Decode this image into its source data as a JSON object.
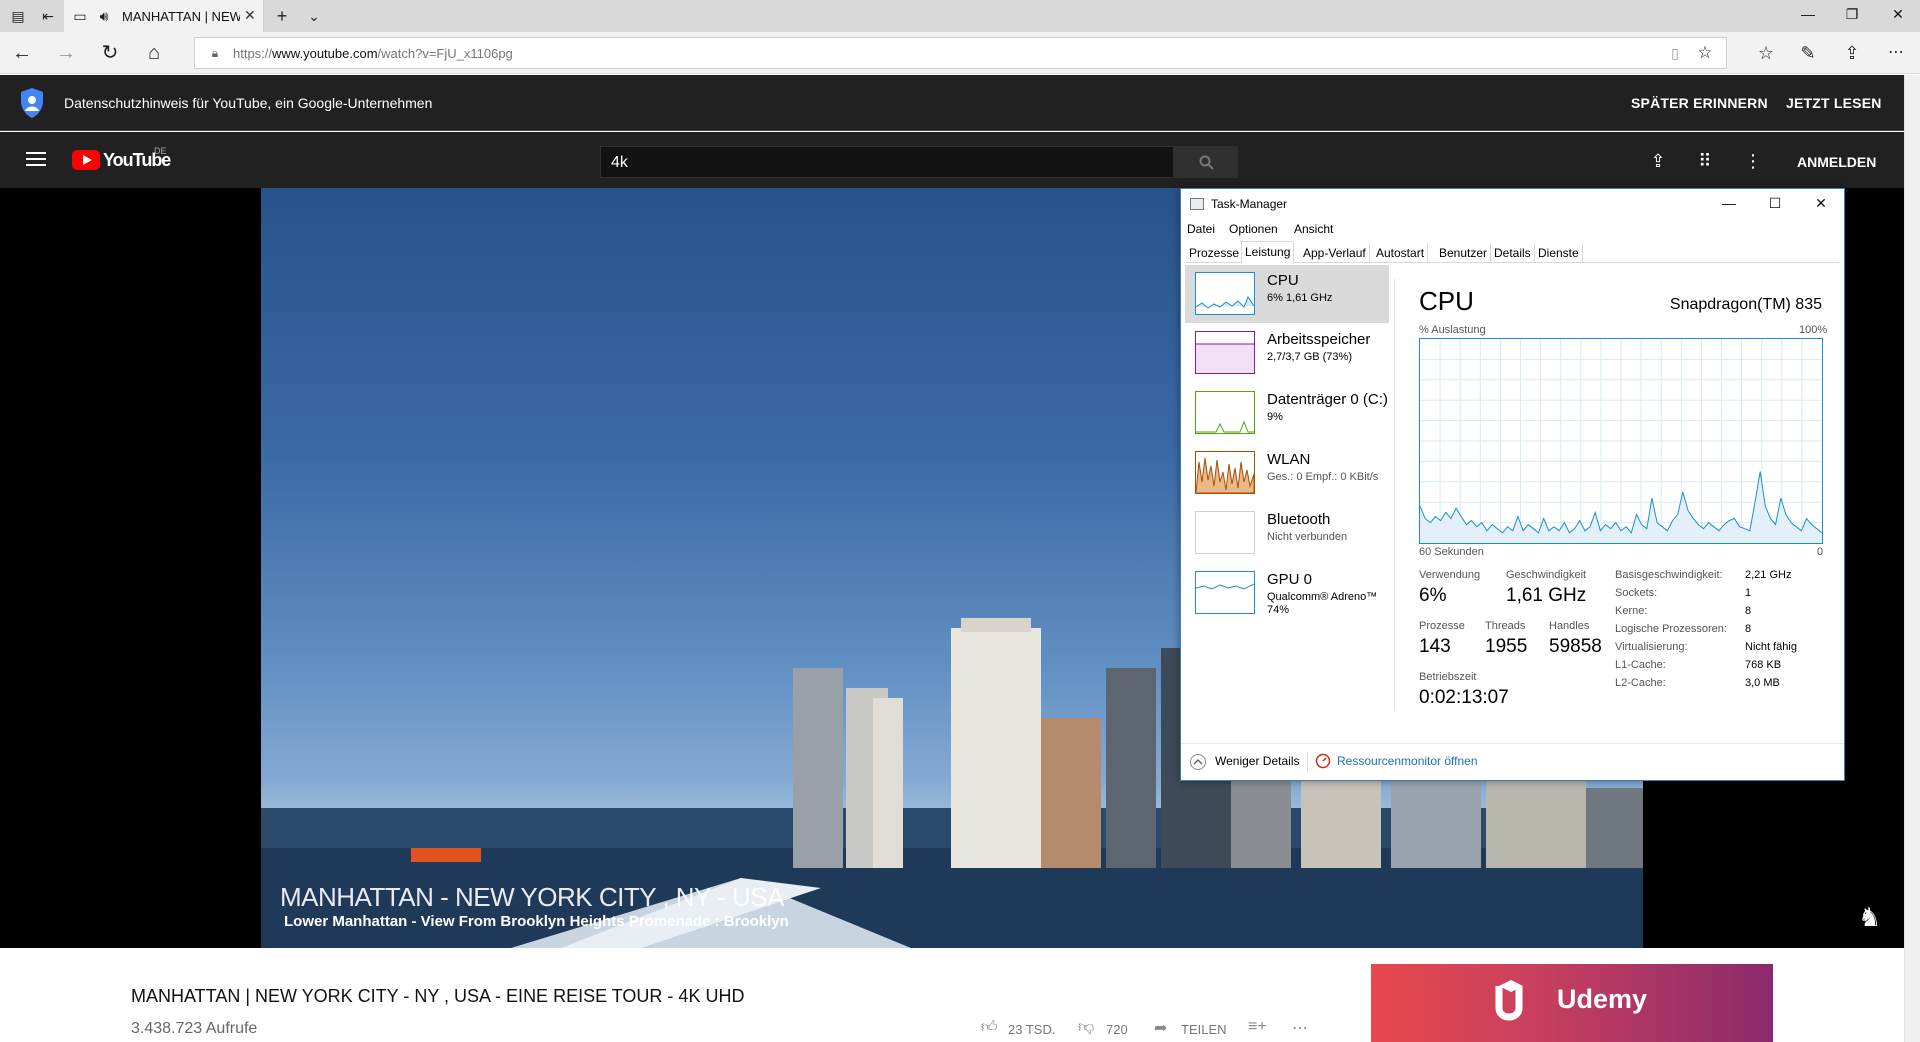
{
  "browser": {
    "tab_title": "MANHATTAN | NEW YORK CITY",
    "url_prefix": "https://",
    "url_host": "www.youtube.com",
    "url_path": "/watch?v=FjU_x1106pg"
  },
  "banner": {
    "text": "Datenschutzhinweis für YouTube, ein Google-Unternehmen",
    "remind_label": "SPÄTER ERINNERN",
    "read_label": "JETZT LESEN"
  },
  "masthead": {
    "logo_text": "YouTube",
    "region": "DE",
    "search_value": "4k",
    "signin_label": "ANMELDEN"
  },
  "video": {
    "overlay_title": "MANHATTAN - NEW YORK CITY , NY - USA",
    "overlay_subtitle": "Lower Manhattan - View From Brooklyn Heights Promenade : Brooklyn",
    "title": "MANHATTAN | NEW YORK CITY - NY , USA - EINE REISE TOUR - 4K UHD",
    "views": "3.438.723 Aufrufe",
    "likes": "23 TSD.",
    "dislikes": "720",
    "share_label": "TEILEN"
  },
  "ad": {
    "brand": "Udemy",
    "color_start": "#e8484c",
    "color_end": "#8a2a6c"
  },
  "taskmanager": {
    "title": "Task-Manager",
    "menu": [
      "Datei",
      "Optionen",
      "Ansicht"
    ],
    "tabs": [
      "Prozesse",
      "Leistung",
      "App-Verlauf",
      "Autostart",
      "Benutzer",
      "Details",
      "Dienste"
    ],
    "active_tab": "Leistung",
    "items": [
      {
        "name": "CPU",
        "sub": "6% 1,61 GHz",
        "color": "#1c8ecf"
      },
      {
        "name": "Arbeitsspeicher",
        "sub": "2,7/3,7 GB (73%)",
        "color": "#8b12ae"
      },
      {
        "name": "Datenträger 0 (C:)",
        "sub": "9%",
        "color": "#4da60c"
      },
      {
        "name": "WLAN",
        "sub_label": "Ges.: 0 Empf.: 0 KBit/s",
        "sub": "Ges.: 0 Empf.: 0 KBit/s",
        "color": "#a74f01"
      },
      {
        "name": "Bluetooth",
        "sub": "Nicht verbunden",
        "color": "#cfcfcf"
      },
      {
        "name": "GPU 0",
        "sub": "Qualcomm® Adreno™",
        "sub2": "74%",
        "color": "#1c8ecf"
      }
    ],
    "detail": {
      "heading": "CPU",
      "processor": "Snapdragon(TM) 835",
      "util_label": "% Auslastung",
      "max_label": "100%",
      "time_label": "60 Sekunden",
      "min_label": "0",
      "usage_label": "Verwendung",
      "usage": "6%",
      "speed_label": "Geschwindigkeit",
      "speed": "1,61 GHz",
      "proc_label": "Prozesse",
      "procs": "143",
      "threads_label": "Threads",
      "threads": "1955",
      "handles_label": "Handles",
      "handles": "59858",
      "uptime_label": "Betriebszeit",
      "uptime": "0:02:13:07",
      "specs": [
        {
          "k": "Basisgeschwindigkeit:",
          "v": "2,21 GHz"
        },
        {
          "k": "Sockets:",
          "v": "1"
        },
        {
          "k": "Kerne:",
          "v": "8"
        },
        {
          "k": "Logische Prozessoren:",
          "v": "8"
        },
        {
          "k": "Virtualisierung:",
          "v": "Nicht fähig"
        },
        {
          "k": "L1-Cache:",
          "v": "768 KB"
        },
        {
          "k": "L2-Cache:",
          "v": "3,0 MB"
        }
      ],
      "cpu_history": [
        18,
        12,
        10,
        13,
        11,
        15,
        12,
        17,
        13,
        9,
        11,
        8,
        10,
        6,
        9,
        7,
        5,
        8,
        6,
        13,
        6,
        9,
        7,
        5,
        12,
        6,
        8,
        6,
        10,
        5,
        7,
        11,
        6,
        8,
        15,
        6,
        9,
        7,
        10,
        6,
        8,
        5,
        14,
        9,
        7,
        22,
        10,
        8,
        6,
        11,
        14,
        25,
        16,
        12,
        9,
        7,
        10,
        8,
        6,
        9,
        11,
        12,
        8,
        7,
        6,
        20,
        35,
        18,
        12,
        9,
        22,
        14,
        10,
        8,
        6,
        12,
        9,
        7,
        5
      ],
      "history_range": [
        0,
        100
      ]
    },
    "less_details": "Weniger Details",
    "resource_monitor": "Ressourcenmonitor öffnen"
  }
}
